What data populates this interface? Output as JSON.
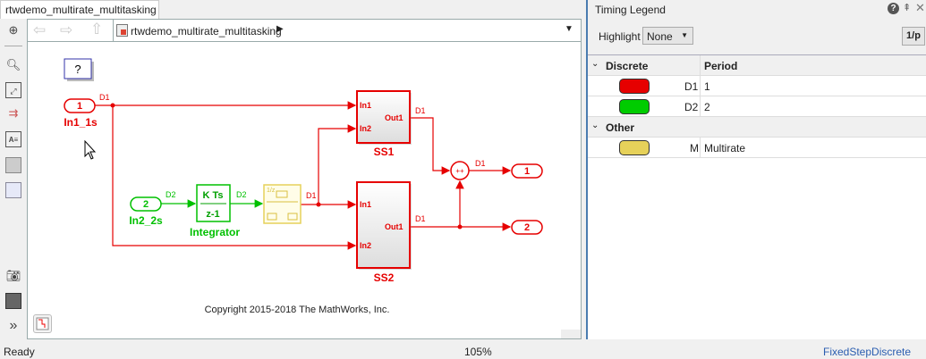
{
  "tab": {
    "title": "rtwdemo_multirate_multitasking"
  },
  "address": {
    "path": "rtwdemo_multirate_multitasking"
  },
  "left_toolbar": [
    "back-icon",
    "zoom-icon",
    "fit-view-icon",
    "signal-arrows-icon",
    "annotation-icon",
    "image-icon",
    "area-icon",
    "camera-icon",
    "model-browser-icon",
    "more-icon"
  ],
  "diagram": {
    "help_block": "?",
    "inports": [
      {
        "num": "1",
        "label": "In1_1s",
        "rate": "D1"
      },
      {
        "num": "2",
        "label": "In2_2s",
        "rate": "D2"
      }
    ],
    "integrator": {
      "num": "K Ts",
      "den": "z-1",
      "label": "Integrator",
      "rate_out": "D2"
    },
    "rate_transition": {
      "text": "1/z",
      "rate_out": "D1"
    },
    "ss1": {
      "label": "SS1",
      "in1": "In1",
      "in2": "In2",
      "out": "Out1",
      "rate": "D1"
    },
    "ss2": {
      "label": "SS2",
      "in1": "In1",
      "in2": "In2",
      "out": "Out1",
      "rate": "D1"
    },
    "sum": {
      "signs": "++",
      "rate": "D1"
    },
    "outports": [
      {
        "num": "1"
      },
      {
        "num": "2"
      }
    ],
    "copyright": "Copyright 2015-2018 The MathWorks, Inc."
  },
  "legend": {
    "title": "Timing Legend",
    "highlight_label": "Highlight",
    "highlight_value": "None",
    "period_button": "1/p",
    "col_discrete": "Discrete",
    "col_period": "Period",
    "rows": [
      {
        "name": "D1",
        "period": "1",
        "color": "#e60000"
      },
      {
        "name": "D2",
        "period": "2",
        "color": "#00cc00"
      }
    ],
    "other_label": "Other",
    "other_rows": [
      {
        "name": "M",
        "period": "Multirate",
        "color": "#e6d15a"
      }
    ]
  },
  "status": {
    "left": "Ready",
    "zoom": "105%",
    "solver": "FixedStepDiscrete"
  },
  "colors": {
    "d1": "#e60000",
    "d2": "#00c000",
    "multirate": "#e6d15a"
  }
}
